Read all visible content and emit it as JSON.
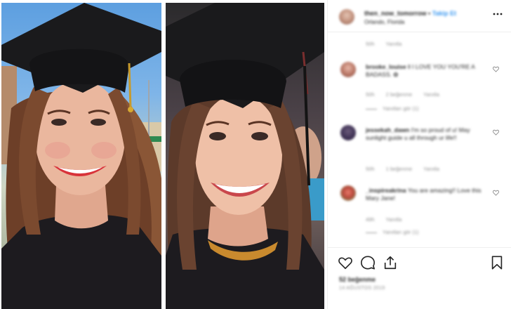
{
  "post": {
    "username": "then_now_tomorrow",
    "follow_sep": "•",
    "follow_label": "Takip Et",
    "location": "Orlando, Florida",
    "more_label": "•••"
  },
  "caption_meta": {
    "time": "50h",
    "reply": "Yanıtla"
  },
  "comments": [
    {
      "user": "brooke_louise",
      "text": "ll I LOVE YOU YOU'RE A BADASS. ✿",
      "heart": "❤",
      "time": "50h",
      "likes": "2 beğenme",
      "reply": "Yanıtla",
      "replies": "Yanıtları gör (1)"
    },
    {
      "user": "jessekah_dawn",
      "text": "I'm so proud of u! May sunlight guide u all through ur life!!",
      "time": "50h",
      "likes": "1 beğenme",
      "reply": "Yanıtla"
    },
    {
      "user": "_inspireakrina",
      "text": "You are amazing!! Love this Mary Jane!",
      "time": "49h",
      "reply": "Yanıtla",
      "replies": "Yanıtları gör (1)"
    }
  ],
  "actions": {
    "likes_label": "52 beğenme",
    "date_label": "14 AĞUSTOS 2019"
  },
  "colors": {
    "accent": "#3897f0",
    "muted": "#8e8e8e",
    "text": "#262626",
    "border": "#efefef",
    "lipstick": "#d8333a",
    "gown": "#1d1b1f"
  },
  "icons": [
    "heart-icon",
    "comment-icon",
    "share-icon",
    "bookmark-icon",
    "more-icon"
  ]
}
